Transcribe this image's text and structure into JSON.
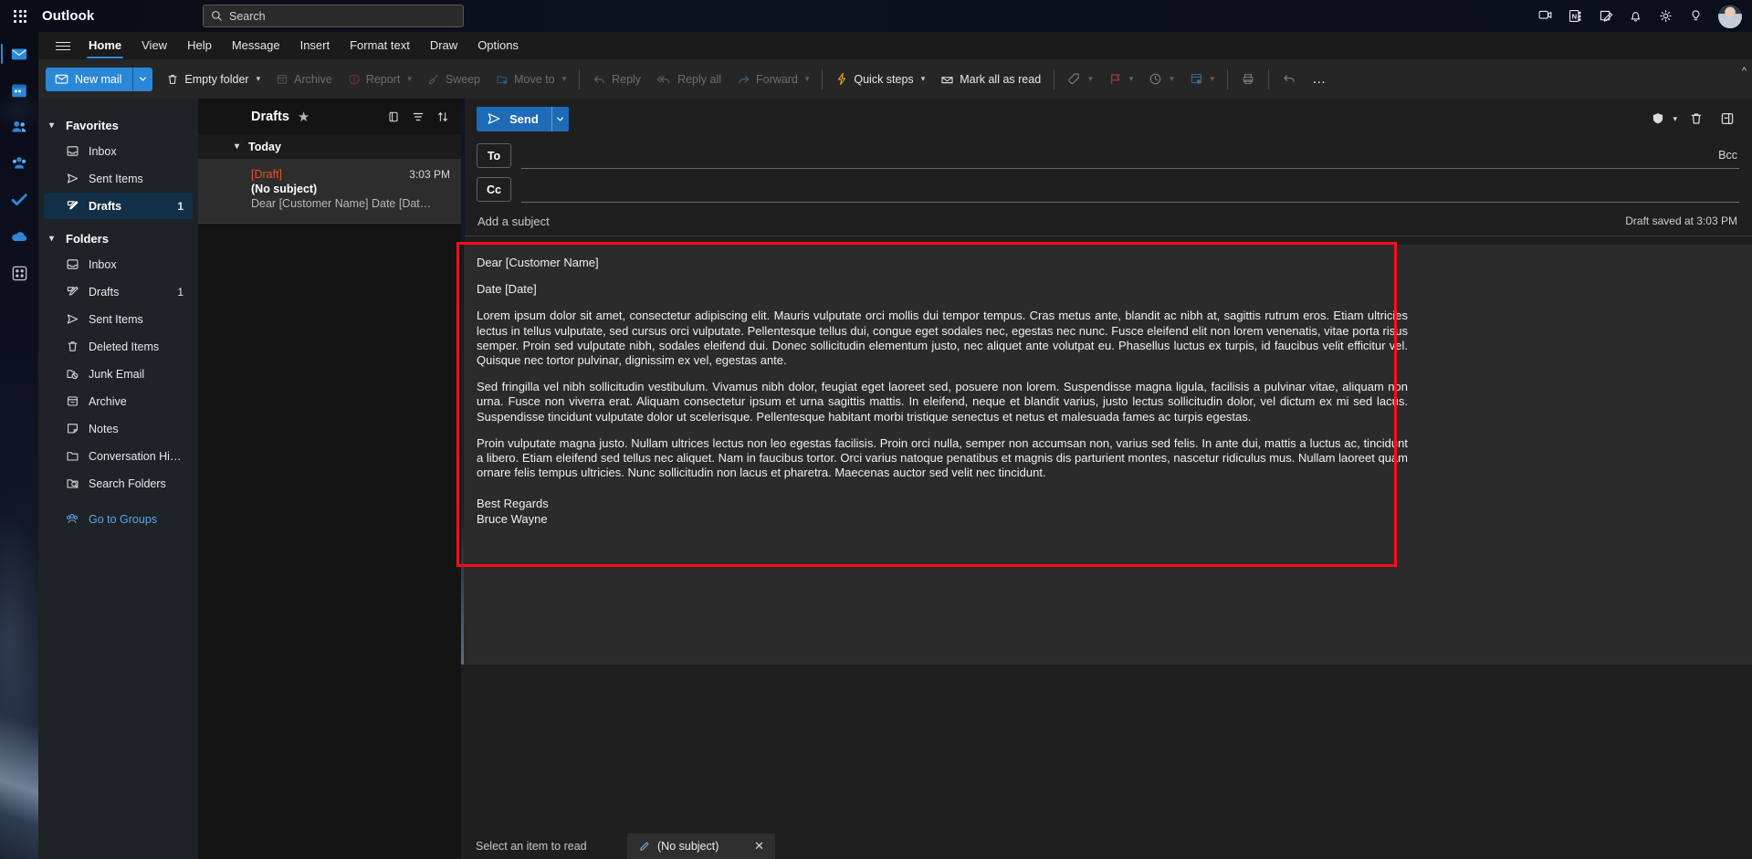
{
  "app": {
    "brand": "Outlook",
    "waffle_icon": "app-launcher-icon"
  },
  "search": {
    "placeholder": "Search",
    "icon": "search-icon"
  },
  "topbar_icons": [
    {
      "name": "meet-now-icon",
      "label": "Meet now"
    },
    {
      "name": "onenote-feed-icon",
      "label": "OneNote feed"
    },
    {
      "name": "my-day-icon",
      "label": "My Day"
    },
    {
      "name": "notifications-bell-icon",
      "label": "Notifications"
    },
    {
      "name": "settings-gear-icon",
      "label": "Settings"
    },
    {
      "name": "help-icon",
      "label": "Help"
    }
  ],
  "rail": [
    {
      "name": "mail",
      "icon": "mail-icon",
      "active": true
    },
    {
      "name": "calendar",
      "icon": "calendar-icon",
      "active": false
    },
    {
      "name": "people",
      "icon": "people-icon",
      "active": false
    },
    {
      "name": "groups",
      "icon": "groups-icon",
      "active": false
    },
    {
      "name": "todo",
      "icon": "checkmark-icon",
      "active": false
    },
    {
      "name": "onedrive",
      "icon": "cloud-icon",
      "active": false
    },
    {
      "name": "apps",
      "icon": "apps-grid-icon",
      "active": false
    }
  ],
  "ribbon": {
    "hamburger_icon": "hamburger-menu-icon",
    "tabs": [
      {
        "label": "Home",
        "active": true
      },
      {
        "label": "View",
        "active": false
      },
      {
        "label": "Help",
        "active": false
      },
      {
        "label": "Message",
        "active": false
      },
      {
        "label": "Insert",
        "active": false
      },
      {
        "label": "Format text",
        "active": false
      },
      {
        "label": "Draw",
        "active": false
      },
      {
        "label": "Options",
        "active": false
      }
    ],
    "new_mail": "New mail",
    "commands": [
      {
        "label": "Empty folder",
        "icon": "trash-icon",
        "disabled": false,
        "chevron": true
      },
      {
        "label": "Archive",
        "icon": "archive-icon",
        "disabled": true,
        "chevron": false
      },
      {
        "label": "Report",
        "icon": "report-icon",
        "disabled": true,
        "chevron": true
      },
      {
        "label": "Sweep",
        "icon": "sweep-icon",
        "disabled": true,
        "chevron": false
      },
      {
        "label": "Move to",
        "icon": "move-to-icon",
        "disabled": true,
        "chevron": true
      },
      {
        "label": "Reply",
        "icon": "reply-icon",
        "disabled": true,
        "chevron": false
      },
      {
        "label": "Reply all",
        "icon": "reply-all-icon",
        "disabled": true,
        "chevron": false
      },
      {
        "label": "Forward",
        "icon": "forward-icon",
        "disabled": true,
        "chevron": true
      },
      {
        "label": "Quick steps",
        "icon": "quick-steps-icon",
        "disabled": false,
        "chevron": true
      },
      {
        "label": "Mark all as read",
        "icon": "mark-read-icon",
        "disabled": false,
        "chevron": false
      }
    ],
    "icon_only_commands": [
      {
        "name": "tag-icon",
        "chevron": true
      },
      {
        "name": "flag-icon",
        "chevron": true
      },
      {
        "name": "snooze-clock-icon",
        "chevron": true
      },
      {
        "name": "rules-icon",
        "chevron": true
      },
      {
        "name": "print-icon",
        "chevron": false
      },
      {
        "name": "undo-icon",
        "chevron": false
      },
      {
        "name": "more-options-icon",
        "chevron": false
      }
    ],
    "collapse_icon": "collapse-ribbon-icon"
  },
  "folder_pane": {
    "favorites": {
      "label": "Favorites",
      "items": [
        {
          "label": "Inbox",
          "icon": "inbox-icon",
          "count": "",
          "selected": false
        },
        {
          "label": "Sent Items",
          "icon": "sent-icon",
          "count": "",
          "selected": false
        },
        {
          "label": "Drafts",
          "icon": "drafts-pencil-icon",
          "count": "1",
          "selected": true
        }
      ]
    },
    "folders": {
      "label": "Folders",
      "items": [
        {
          "label": "Inbox",
          "icon": "inbox-icon",
          "count": "",
          "selected": false
        },
        {
          "label": "Drafts",
          "icon": "drafts-pencil-icon",
          "count": "1",
          "selected": false
        },
        {
          "label": "Sent Items",
          "icon": "sent-icon",
          "count": "",
          "selected": false
        },
        {
          "label": "Deleted Items",
          "icon": "trash-icon",
          "count": "",
          "selected": false
        },
        {
          "label": "Junk Email",
          "icon": "junk-folder-icon",
          "count": "",
          "selected": false
        },
        {
          "label": "Archive",
          "icon": "archive-icon",
          "count": "",
          "selected": false
        },
        {
          "label": "Notes",
          "icon": "notes-icon",
          "count": "",
          "selected": false
        },
        {
          "label": "Conversation Histo...",
          "icon": "folder-icon",
          "count": "",
          "selected": false
        },
        {
          "label": "Search Folders",
          "icon": "search-folder-icon",
          "count": "",
          "selected": false
        }
      ]
    },
    "go_to_groups": {
      "label": "Go to Groups",
      "icon": "groups-icon"
    }
  },
  "list_pane": {
    "title": "Drafts",
    "star_icon": "star-filled-icon",
    "actions": [
      {
        "name": "conversation-view-icon"
      },
      {
        "name": "filter-icon"
      },
      {
        "name": "sort-icon"
      }
    ],
    "day_group": {
      "label": "Today",
      "twisty": "chevron-down-icon"
    },
    "rows": [
      {
        "draft_tag": "[Draft]",
        "subject": "(No subject)",
        "preview": "Dear [Customer Name] Date [Date] ...",
        "time": "3:03 PM"
      }
    ]
  },
  "compose": {
    "send_label": "Send",
    "send_icon": "send-paperplane-icon",
    "send_split_icon": "chevron-down-icon",
    "header_actions": [
      {
        "name": "protection-shield-icon",
        "chevron": true
      },
      {
        "name": "discard-trash-icon",
        "chevron": false
      },
      {
        "name": "popout-icon",
        "chevron": false
      }
    ],
    "to_label": "To",
    "to_value": "",
    "cc_label": "Cc",
    "cc_value": "",
    "bcc_label": "Bcc",
    "subject_placeholder": "Add a subject",
    "subject_value": "",
    "draft_status": "Draft saved at 3:03 PM",
    "body": {
      "greeting": "Dear [Customer Name]",
      "date_line": "Date [Date]",
      "paragraph_1": "Lorem ipsum dolor sit amet, consectetur adipiscing elit. Mauris vulputate orci mollis dui tempor tempus. Cras metus ante, blandit ac nibh at, sagittis rutrum eros. Etiam ultricies lectus in tellus vulputate, sed cursus orci vulputate. Pellentesque tellus dui, congue eget sodales nec, egestas nec nunc. Fusce eleifend elit non lorem venenatis, vitae porta risus semper. Proin sed vulputate nibh, sodales eleifend dui. Donec sollicitudin elementum justo, nec aliquet ante volutpat eu. Phasellus luctus ex turpis, id faucibus velit efficitur vel. Quisque nec tortor pulvinar, dignissim ex vel, egestas ante.",
      "paragraph_2": "Sed fringilla vel nibh sollicitudin vestibulum. Vivamus nibh dolor, feugiat eget laoreet sed, posuere non lorem. Suspendisse magna ligula, facilisis a pulvinar vitae, aliquam non urna. Fusce non viverra erat. Aliquam consectetur ipsum et urna sagittis mattis. In eleifend, neque et blandit varius, justo lectus sollicitudin dolor, vel dictum ex mi sed lacus. Suspendisse tincidunt vulputate dolor ut scelerisque. Pellentesque habitant morbi tristique senectus et netus et malesuada fames ac turpis egestas.",
      "paragraph_3": "Proin vulputate magna justo. Nullam ultrices lectus non leo egestas facilisis. Proin orci nulla, semper non accumsan non, varius sed felis. In ante dui, mattis a luctus ac, tincidunt a libero. Etiam eleifend sed tellus nec aliquet. Nam in faucibus tortor. Orci varius natoque penatibus et magnis dis parturient montes, nascetur ridiculus mus. Nullam laoreet quam ornare felis tempus ultricies. Nunc sollicitudin non lacus et pharetra. Maecenas auctor sed velit nec tincidunt.",
      "signoff": "Best Regards",
      "signature_name": "Bruce Wayne"
    }
  },
  "bottom_bar": {
    "reading_hint": "Select an item to read",
    "tab": {
      "label": "(No subject)",
      "icon": "compose-pencil-icon",
      "close_icon": "close-x-icon"
    }
  },
  "colors": {
    "accent": "#2b88d8",
    "send_button": "#1e6bb8",
    "draft_tag": "#e8502a",
    "highlight_box": "#fc0d1b",
    "link": "#5aa8ef"
  }
}
